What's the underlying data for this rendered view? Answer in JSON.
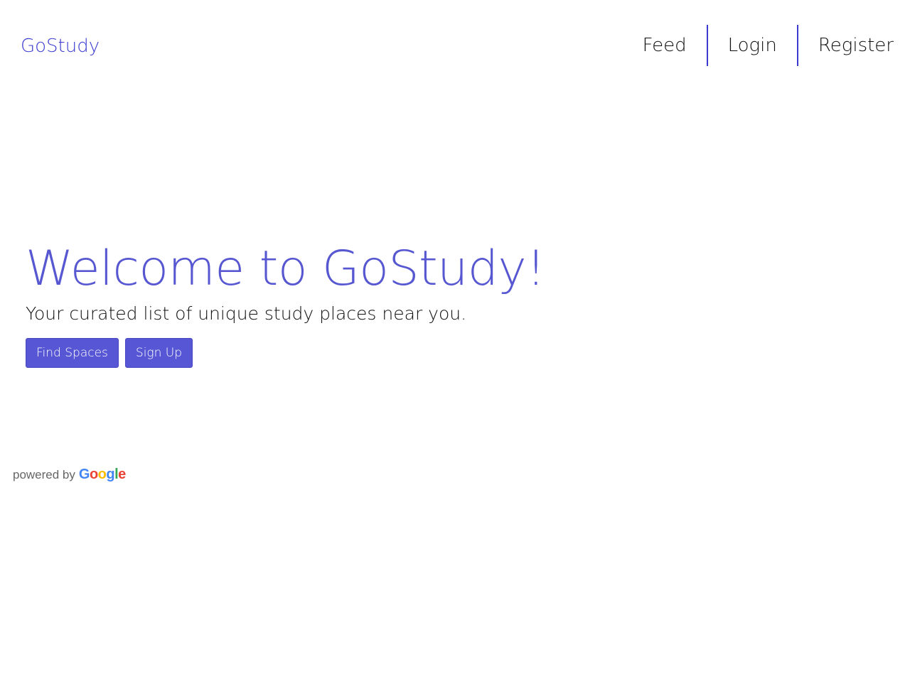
{
  "navbar": {
    "brand": "GoStudy",
    "links": [
      {
        "label": "Feed"
      },
      {
        "label": "Login"
      },
      {
        "label": "Register"
      }
    ]
  },
  "hero": {
    "title": "Welcome to GoStudy!",
    "subtitle": "Your curated list of unique study places near you.",
    "buttons": {
      "find_spaces": "Find Spaces",
      "sign_up": "Sign Up"
    }
  },
  "attribution": {
    "text": "powered by",
    "logo": "Google"
  },
  "colors": {
    "accent": "#5757d6",
    "brand": "#3b3bd1",
    "text": "#111111"
  }
}
